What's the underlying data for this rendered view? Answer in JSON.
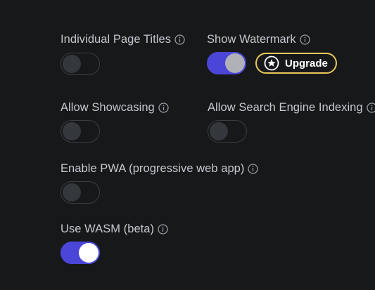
{
  "settings": {
    "page_titles": {
      "label": "Individual Page Titles",
      "enabled": false
    },
    "watermark": {
      "label": "Show Watermark",
      "enabled": true,
      "upgrade_label": "Upgrade"
    },
    "showcasing": {
      "label": "Allow Showcasing",
      "enabled": false
    },
    "search_indexing": {
      "label": "Allow Search Engine Indexing",
      "enabled": false
    },
    "pwa": {
      "label": "Enable PWA (progressive web app)",
      "enabled": false
    },
    "wasm": {
      "label": "Use WASM (beta)",
      "enabled": true
    }
  },
  "icons": {
    "info": "info-circle-icon",
    "star": "star-badge-icon"
  },
  "colors": {
    "background": "#17181a",
    "toggle_on": "#4b46d8",
    "upgrade_border": "#e9c85c",
    "label_text": "#c5c8cf"
  }
}
